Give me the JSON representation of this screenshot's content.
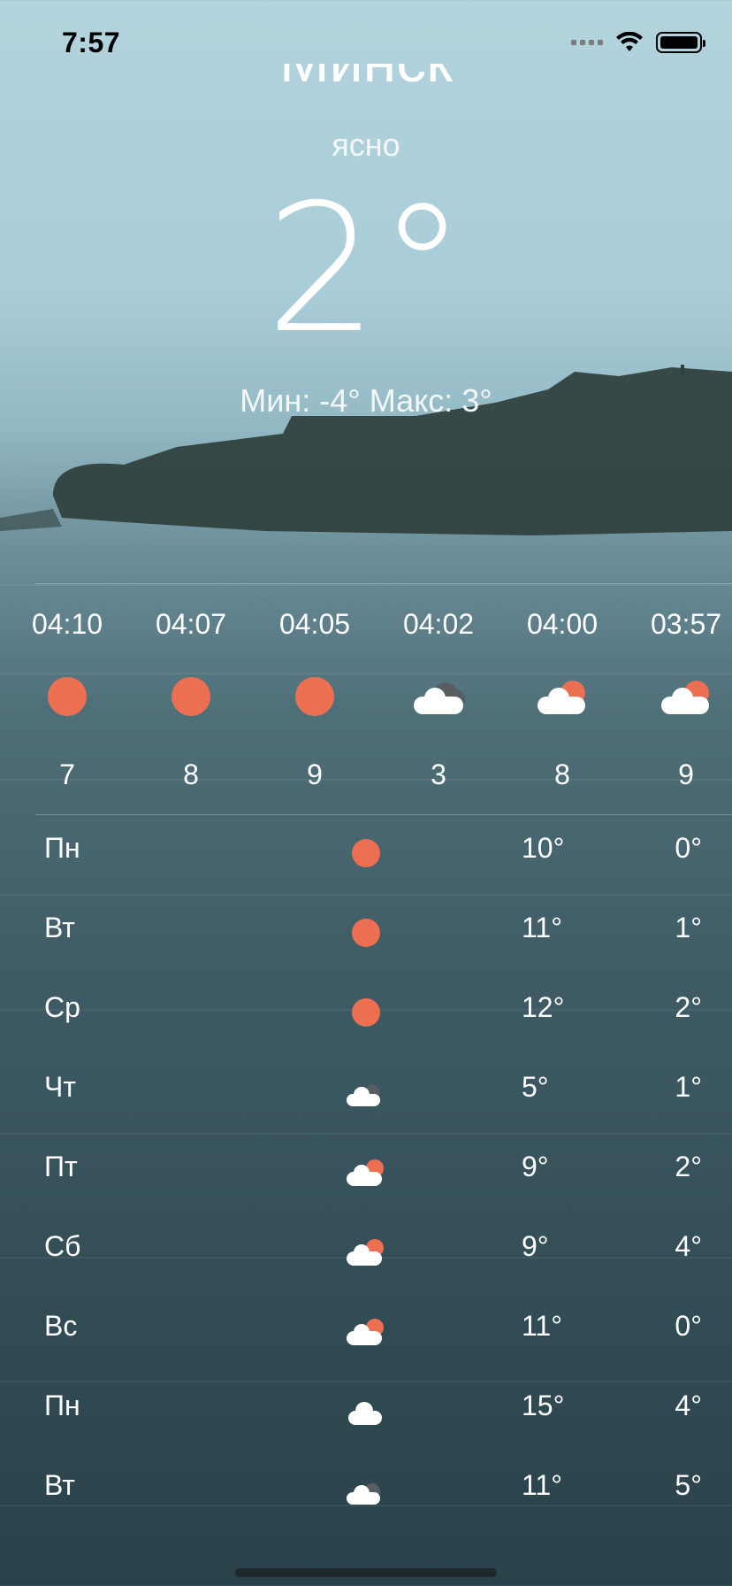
{
  "status": {
    "time": "7:57"
  },
  "header": {
    "city": "Минск",
    "condition": "ясно",
    "temperature": "2°",
    "minmax": "Мин: -4° Макс: 3°"
  },
  "hourly": [
    {
      "time": "04:10",
      "icon": "sun-icon",
      "value": "7"
    },
    {
      "time": "04:07",
      "icon": "sun-icon",
      "value": "8"
    },
    {
      "time": "04:05",
      "icon": "sun-icon",
      "value": "9"
    },
    {
      "time": "04:02",
      "icon": "cloud-dark-icon",
      "value": "3"
    },
    {
      "time": "04:00",
      "icon": "cloud-sun-icon",
      "value": "8"
    },
    {
      "time": "03:57",
      "icon": "cloud-sun-icon",
      "value": "9"
    }
  ],
  "daily": [
    {
      "day": "Пн",
      "icon": "sun-icon",
      "max": "10°",
      "min": "0°"
    },
    {
      "day": "Вт",
      "icon": "sun-icon",
      "max": "11°",
      "min": "1°"
    },
    {
      "day": "Ср",
      "icon": "sun-icon",
      "max": "12°",
      "min": "2°"
    },
    {
      "day": "Чт",
      "icon": "cloud-dark-icon",
      "max": "5°",
      "min": "1°"
    },
    {
      "day": "Пт",
      "icon": "cloud-sun-icon",
      "max": "9°",
      "min": "2°"
    },
    {
      "day": "Сб",
      "icon": "cloud-sun-icon",
      "max": "9°",
      "min": "4°"
    },
    {
      "day": "Вс",
      "icon": "cloud-sun-icon",
      "max": "11°",
      "min": "0°"
    },
    {
      "day": "Пн",
      "icon": "cloud-icon",
      "max": "15°",
      "min": "4°"
    },
    {
      "day": "Вт",
      "icon": "cloud-dark-icon",
      "max": "11°",
      "min": "5°"
    }
  ],
  "colors": {
    "sun": "#ec6f52",
    "cloud": "#ffffff",
    "cloud_dark": "#585d63"
  }
}
